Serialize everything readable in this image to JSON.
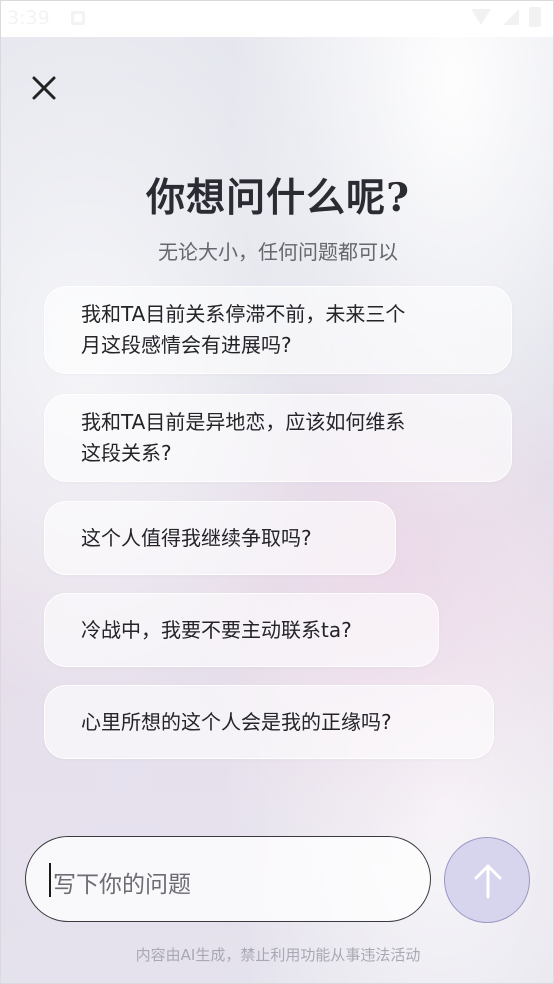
{
  "status_bar": {
    "time": "3:39"
  },
  "header": {
    "close_icon": "close-icon"
  },
  "main": {
    "title": "你想问什么呢?",
    "subtitle": "无论大小，任何问题都可以",
    "suggestions": [
      {
        "line1": "我和TA目前关系停滞不前，未来三个",
        "line2": "月这段感情会有进展吗?"
      },
      {
        "line1": "我和TA目前是异地恋，应该如何维系",
        "line2": "这段关系?"
      },
      {
        "line1": "这个人值得我继续争取吗?"
      },
      {
        "line1": "冷战中，我要不要主动联系ta?"
      },
      {
        "line1": "心里所想的这个人会是我的正缘吗?"
      }
    ]
  },
  "composer": {
    "placeholder": "写下你的问题",
    "send_icon": "arrow-up-icon"
  },
  "footer": {
    "disclaimer": "内容由AI生成，禁止利用功能从事违法活动"
  },
  "colors": {
    "accent_send": "#d7d5ee",
    "title": "#2b2b33",
    "subtitle": "#66666e"
  }
}
